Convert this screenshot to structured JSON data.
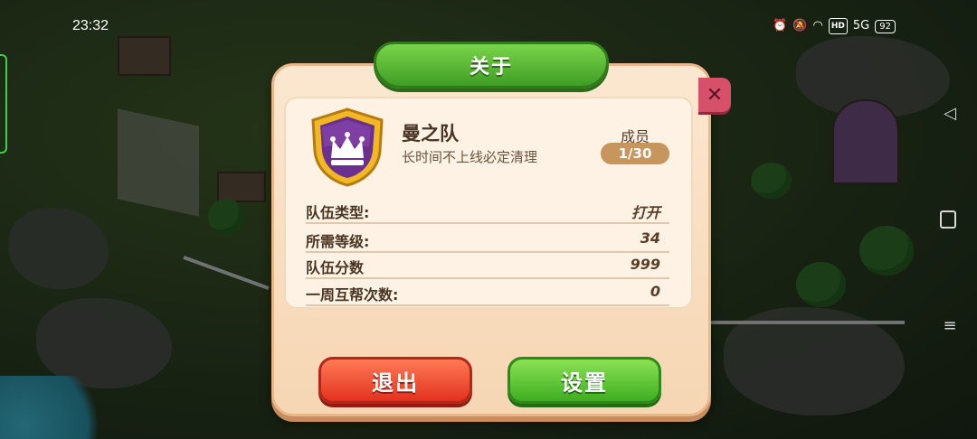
{
  "status_bar": {
    "time": "23:32",
    "hd": "HD",
    "network": "5G",
    "battery": "92"
  },
  "dialog": {
    "title": "关于",
    "close_icon": "close-icon",
    "team": {
      "name": "曼之队",
      "description": "长时间不上线必定清理",
      "emblem": "purple-crown-shield"
    },
    "members": {
      "label": "成员",
      "value": "1/30"
    },
    "info_rows": [
      {
        "label": "队伍类型:",
        "value": "打开"
      },
      {
        "label": "所需等级:",
        "value": "34"
      },
      {
        "label": "队伍分数",
        "value": "999"
      },
      {
        "label": "一周互帮次数:",
        "value": "0"
      }
    ],
    "buttons": {
      "exit": "退出",
      "settings": "设置"
    }
  },
  "colors": {
    "title_green": "#4fb52f",
    "exit_red": "#e2321f",
    "settings_green": "#3fae22",
    "panel_cream": "#fbe7d0",
    "shield_purple": "#6b2f8f",
    "shield_gold": "#f2b824"
  }
}
